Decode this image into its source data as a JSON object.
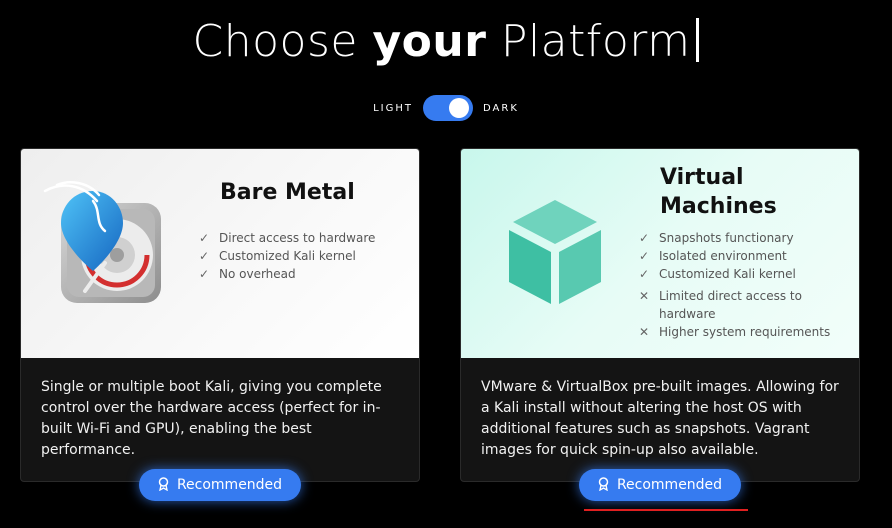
{
  "header": {
    "title_light": "Choose",
    "title_bold": "your",
    "title_end": "Platform"
  },
  "theme_toggle": {
    "light_label": "LIGHT",
    "dark_label": "DARK",
    "state": "dark"
  },
  "cards": [
    {
      "title": "Bare Metal",
      "features": [
        {
          "type": "pro",
          "text": "Direct access to hardware"
        },
        {
          "type": "pro",
          "text": "Customized Kali kernel"
        },
        {
          "type": "pro",
          "text": "No overhead"
        }
      ],
      "description": "Single or multiple boot Kali, giving you complete control over the hardware access (perfect for in-built Wi-Fi and GPU), enabling the best performance.",
      "button_label": "Recommended"
    },
    {
      "title_line1": "Virtual",
      "title_line2": "Machines",
      "features": [
        {
          "type": "pro",
          "text": "Snapshots functionary"
        },
        {
          "type": "pro",
          "text": "Isolated environment"
        },
        {
          "type": "pro",
          "text": "Customized Kali kernel"
        },
        {
          "type": "con",
          "text": "Limited direct access to hardware"
        },
        {
          "type": "con",
          "text": "Higher system requirements"
        }
      ],
      "description": "VMware & VirtualBox pre-built images. Allowing for a Kali install without altering the host OS with additional features such as snapshots. Vagrant images for quick spin-up also available.",
      "button_label": "Recommended"
    }
  ],
  "icons": {
    "check": "✓",
    "cross": "✕",
    "award": "award-icon"
  },
  "colors": {
    "accent": "#367bf0",
    "underline": "#e02020"
  }
}
